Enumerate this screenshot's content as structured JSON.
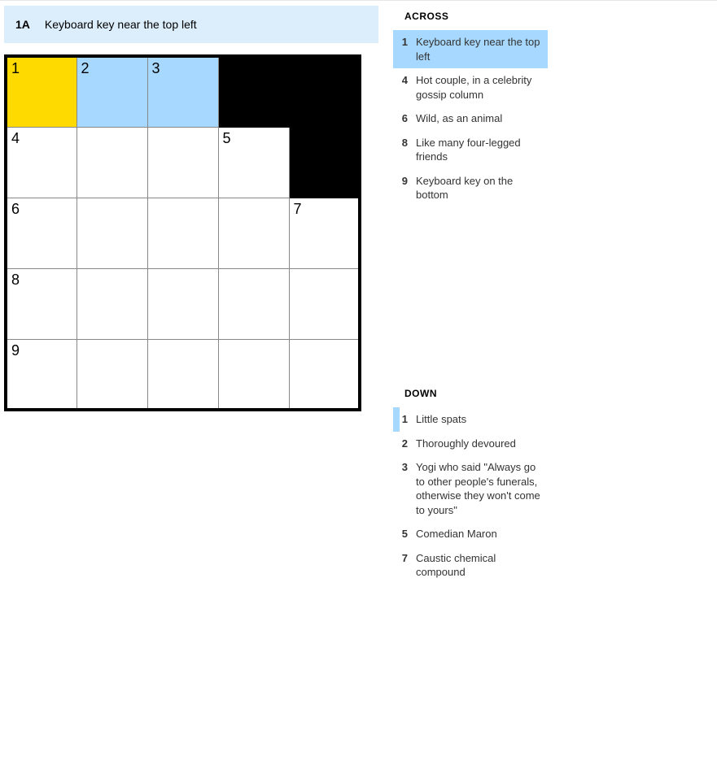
{
  "current_clue": {
    "label": "1A",
    "text": "Keyboard key near the top left"
  },
  "grid": {
    "size": 5,
    "rows": [
      [
        {
          "num": "1",
          "state": "cursor"
        },
        {
          "num": "2",
          "state": "word"
        },
        {
          "num": "3",
          "state": "word"
        },
        {
          "state": "black"
        },
        {
          "state": "black"
        }
      ],
      [
        {
          "num": "4"
        },
        {},
        {},
        {
          "num": "5"
        },
        {
          "state": "black"
        }
      ],
      [
        {
          "num": "6"
        },
        {},
        {},
        {},
        {
          "num": "7"
        }
      ],
      [
        {
          "num": "8"
        },
        {},
        {},
        {},
        {}
      ],
      [
        {
          "num": "9"
        },
        {},
        {},
        {},
        {}
      ]
    ]
  },
  "across": {
    "heading": "ACROSS",
    "clues": [
      {
        "num": "1",
        "text": "Keyboard key near the top left",
        "selected": true
      },
      {
        "num": "4",
        "text": "Hot couple, in a celebrity gossip column"
      },
      {
        "num": "6",
        "text": "Wild, as an animal"
      },
      {
        "num": "8",
        "text": "Like many four-legged friends"
      },
      {
        "num": "9",
        "text": "Keyboard key on the bottom"
      }
    ]
  },
  "down": {
    "heading": "DOWN",
    "clues": [
      {
        "num": "1",
        "text": "Little spats",
        "marked": true
      },
      {
        "num": "2",
        "text": "Thoroughly devoured"
      },
      {
        "num": "3",
        "text": "Yogi who said \"Always go to other people's funerals, otherwise they won't come to yours\""
      },
      {
        "num": "5",
        "text": "Comedian Maron"
      },
      {
        "num": "7",
        "text": "Caustic chemical compound"
      }
    ]
  }
}
